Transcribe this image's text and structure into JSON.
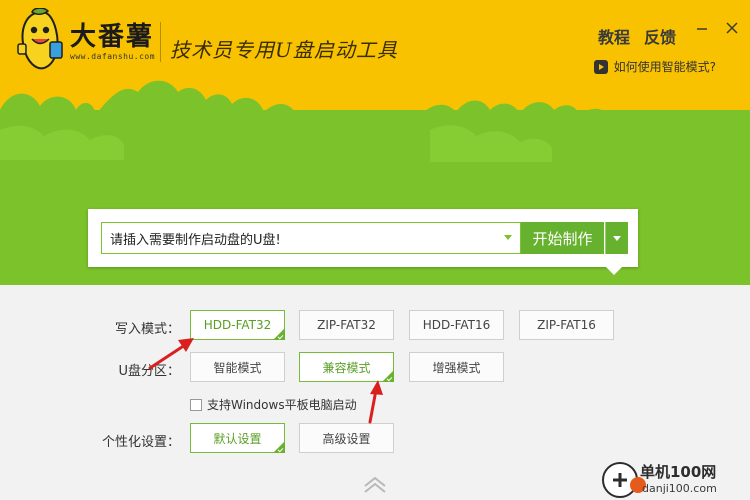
{
  "brand": {
    "name": "大番薯",
    "url": "www.dafanshu.com",
    "slogan": "技术员专用U盘启动工具"
  },
  "header": {
    "tutorial_label": "教程",
    "feedback_label": "反馈",
    "help_link": "如何使用智能模式?"
  },
  "usb": {
    "placeholder": "请插入需要制作启动盘的U盘!",
    "start_button": "开始制作"
  },
  "options": {
    "write_mode": {
      "label": "写入模式：",
      "items": [
        "HDD-FAT32",
        "ZIP-FAT32",
        "HDD-FAT16",
        "ZIP-FAT16"
      ],
      "selected": "HDD-FAT32"
    },
    "partition": {
      "label": "U盘分区：",
      "items": [
        "智能模式",
        "兼容模式",
        "增强模式"
      ],
      "selected": "兼容模式"
    },
    "windows_tablet": {
      "label": "支持Windows平板电脑启动",
      "checked": false
    },
    "personalize": {
      "label": "个性化设置：",
      "items": [
        "默认设置",
        "高级设置"
      ],
      "selected": "默认设置"
    }
  },
  "watermark": {
    "name": "单机100网",
    "url": "danji100.com"
  },
  "colors": {
    "header_yellow": "#f8c200",
    "green": "#7cc22a",
    "button_green": "#66b12d",
    "annotation_red": "#d9201f"
  }
}
